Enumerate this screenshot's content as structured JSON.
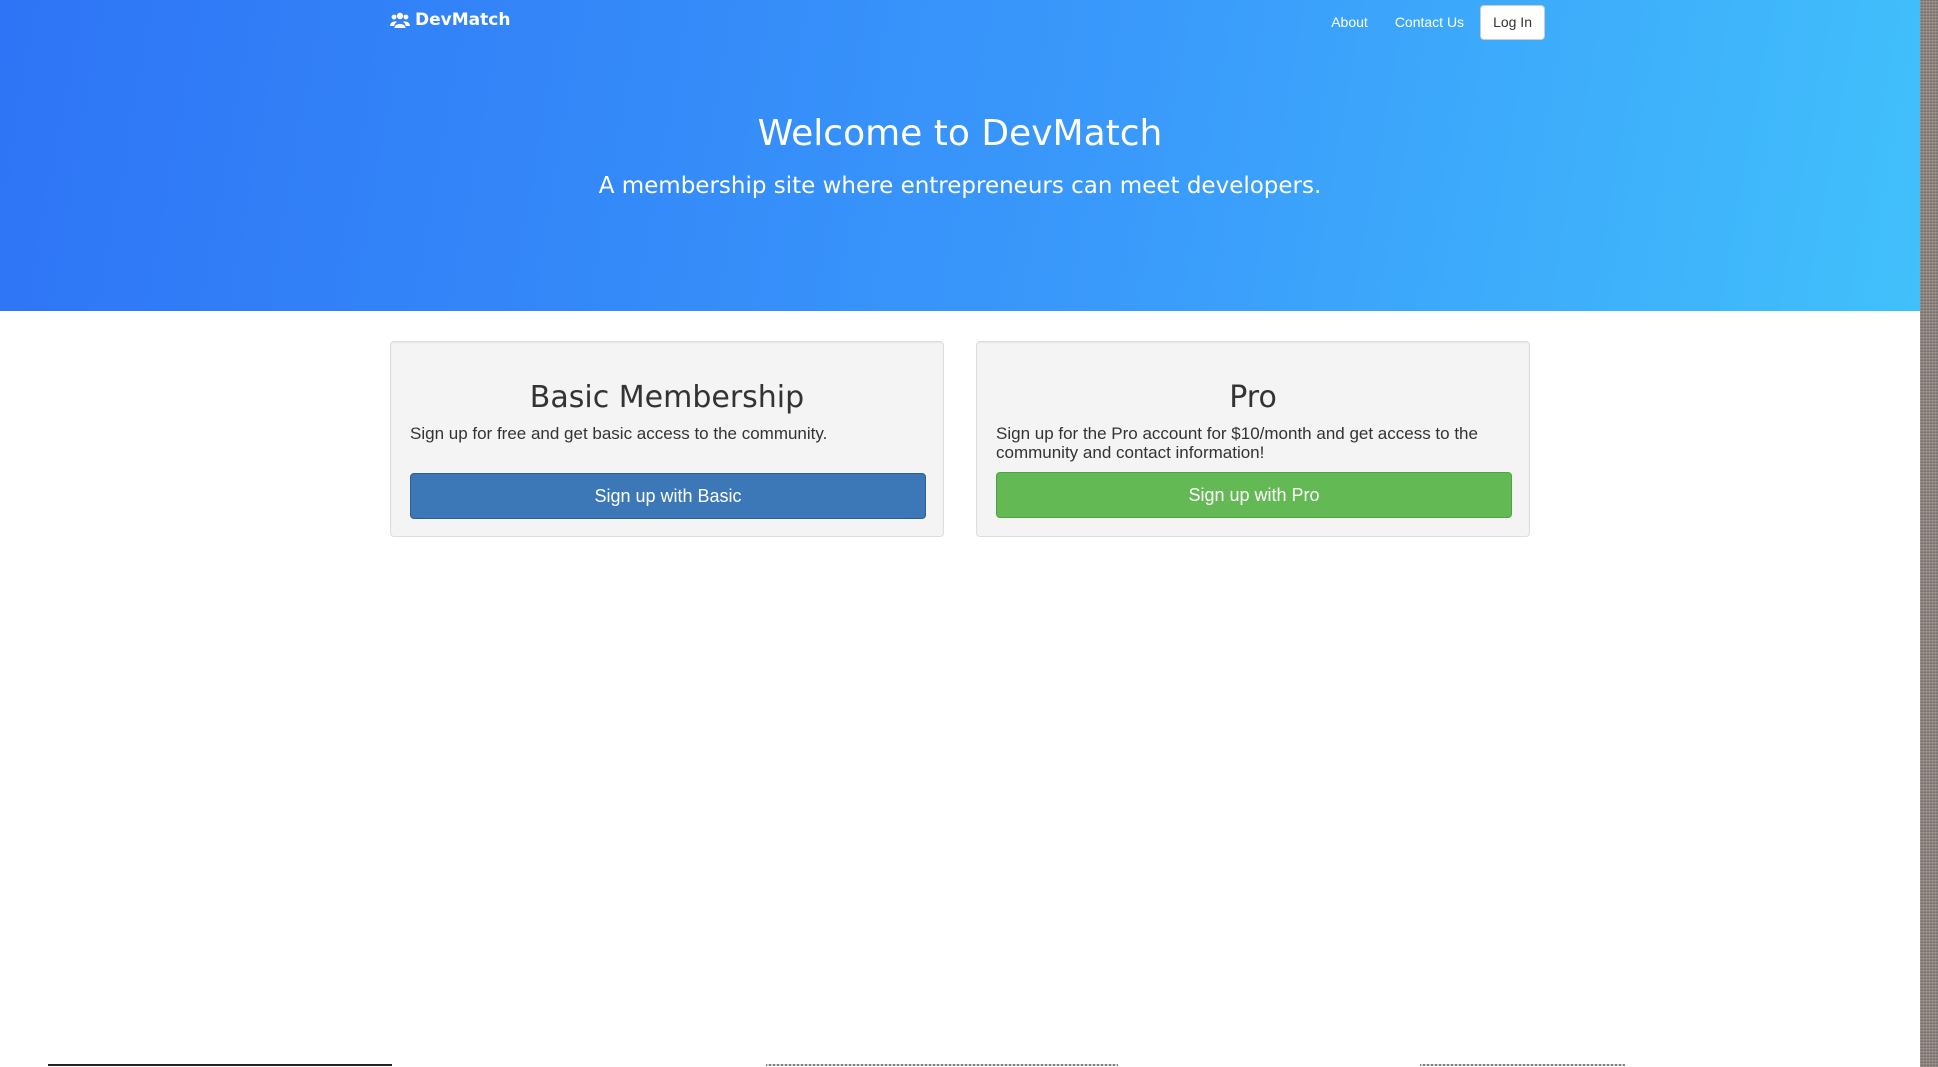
{
  "navbar": {
    "brand": "DevMatch",
    "brand_icon": "users-icon",
    "links": [
      "About",
      "Contact Us"
    ],
    "login_label": "Log In"
  },
  "hero": {
    "title": "Welcome to DevMatch",
    "subtitle": "A membership site where entrepreneurs can meet developers.",
    "gradient_colors": [
      "#2e74f6",
      "#41c0fb"
    ]
  },
  "plans": [
    {
      "title": "Basic Membership",
      "description": "Sign up for free and get basic access to the community.",
      "button_label": "Sign up with Basic",
      "button_color": "#3c77b7"
    },
    {
      "title": "Pro",
      "description": "Sign up for the Pro account for $10/month and get access to the community and contact information!",
      "button_label": "Sign up with Pro",
      "button_color": "#63b954"
    }
  ]
}
